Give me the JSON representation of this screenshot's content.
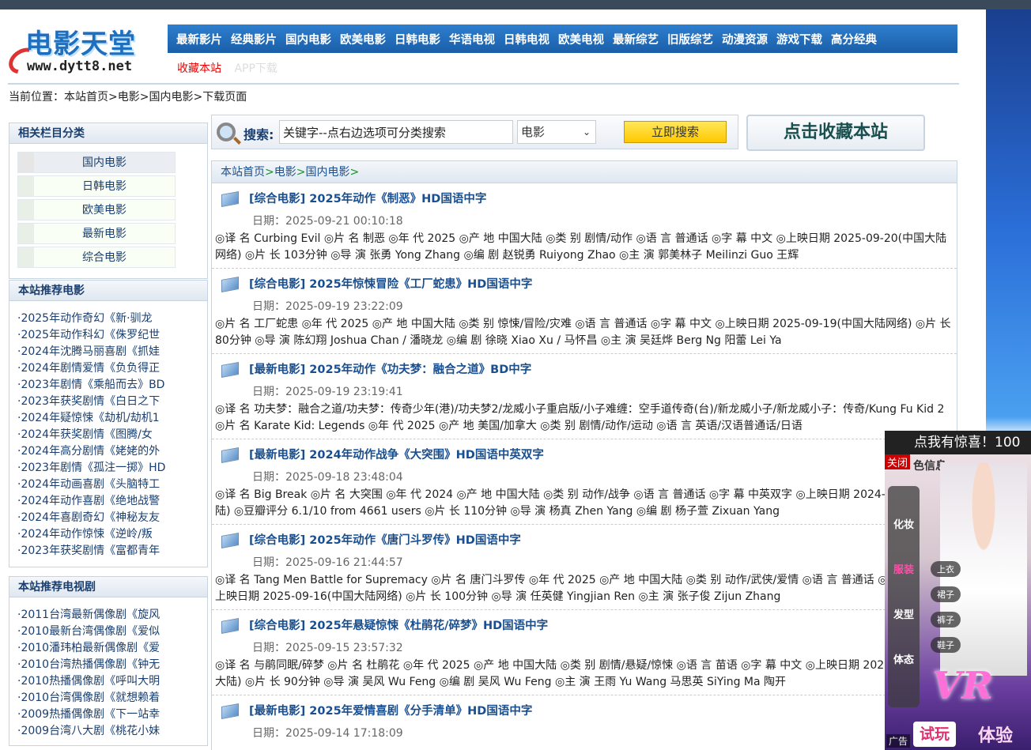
{
  "logo": {
    "brand": "电影天堂",
    "url": "www.dytt8.net"
  },
  "nav": [
    "最新影片",
    "经典影片",
    "国内电影",
    "欧美电影",
    "日韩电影",
    "华语电视",
    "日韩电视",
    "欧美电视",
    "最新综艺",
    "旧版综艺",
    "动漫资源",
    "游戏下载",
    "高分经典"
  ],
  "subnav": {
    "favorite": "收藏本站",
    "app": "APP下载"
  },
  "location": {
    "prefix": "当前位置：",
    "path": [
      "本站首页",
      "电影",
      "国内电影",
      "下载页面"
    ],
    "sep": ">"
  },
  "categories": {
    "title": "相关栏目分类",
    "items": [
      "国内电影",
      "日韩电影",
      "欧美电影",
      "最新电影",
      "综合电影"
    ]
  },
  "rec_movies": {
    "title": "本站推荐电影",
    "items": [
      "·2025年动作奇幻《新·驯龙",
      "·2025年动作科幻《侏罗纪世",
      "·2024年沈腾马丽喜剧《抓娃",
      "·2024年剧情爱情《负负得正",
      "·2023年剧情《乘船而去》BD",
      "·2023年获奖剧情《白日之下",
      "·2024年疑惊悚《劫机/劫机1",
      "·2024年获奖剧情《图腾/女",
      "·2024年高分剧情《姥姥的外",
      "·2023年剧情《孤注一掷》HD",
      "·2024年动画喜剧《头脑特工",
      "·2024年动作喜剧《绝地战警",
      "·2024年喜剧奇幻《神秘友友",
      "·2024年动作惊悚《逆岭/叛",
      "·2023年获奖剧情《富都青年"
    ]
  },
  "rec_tv": {
    "title": "本站推荐电视剧",
    "items": [
      "·2011台湾最新偶像剧《旋风",
      "·2010最新台湾偶像剧《爱似",
      "·2010潘玮柏最新偶像剧《爱",
      "·2010台湾热播偶像剧《钟无",
      "·2010热播偶像剧《呼叫大明",
      "·2010台湾偶像剧《就想赖着",
      "·2009热播偶像剧《下一站幸",
      "·2009台湾八大剧《桃花小妹"
    ]
  },
  "search": {
    "label": "搜索:",
    "value": "关键字--点右边选项可分类搜索",
    "type": "电影",
    "button": "立即搜索"
  },
  "fav_button": "点击收藏本站",
  "main_crumb": [
    "本站首页",
    "电影",
    "国内电影"
  ],
  "items": [
    {
      "title": "[综合电影] 2025年动作《制恶》HD国语中字",
      "date": "日期：2025-09-21 00:10:18",
      "desc": "◎译 名 Curbing Evil ◎片 名 制恶 ◎年 代 2025 ◎产 地 中国大陆 ◎类 别 剧情/动作 ◎语 言 普通话 ◎字 幕 中文 ◎上映日期 2025-09-20(中国大陆网络) ◎片 长 103分钟 ◎导 演 张勇 Yong Zhang ◎编 剧 赵锐勇 Ruiyong Zhao ◎主 演 郭美林子 Meilinzi Guo 王辉"
    },
    {
      "title": "[综合电影] 2025年惊悚冒险《工厂蛇患》HD国语中字",
      "date": "日期：2025-09-19 23:22:09",
      "desc": "◎片 名 工厂蛇患 ◎年 代 2025 ◎产 地 中国大陆 ◎类 别 惊悚/冒险/灾难 ◎语 言 普通话 ◎字 幕 中文 ◎上映日期 2025-09-19(中国大陆网络) ◎片 长 80分钟 ◎导 演 陈幻翔 Joshua Chan / 潘晓龙 ◎编 剧 徐晓 Xiao Xu / 马怀昌 ◎主 演 吴廷烨 Berg Ng 阳蕾 Lei Ya"
    },
    {
      "title": "[最新电影] 2025年动作《功夫梦：融合之道》BD中字",
      "date": "日期：2025-09-19 23:19:41",
      "desc": "◎译 名 功夫梦：融合之道/功夫梦：传奇少年(港)/功夫梦2/龙威小子重启版/小子难缠：空手道传奇(台)/新龙威小子/新龙威小子：传奇/Kung Fu Kid 2 ◎片 名 Karate Kid: Legends ◎年 代 2025 ◎产 地 美国/加拿大 ◎类 别 剧情/动作/运动 ◎语 言 英语/汉语普通话/日语"
    },
    {
      "title": "[最新电影] 2024年动作战争《大突围》HD国语中英双字",
      "date": "日期：2025-09-18 23:48:04",
      "desc": "◎译 名 Big Break ◎片 名 大突围 ◎年 代 2024 ◎产 地 中国大陆 ◎类 别 动作/战争 ◎语 言 普通话 ◎字 幕 中英双字 ◎上映日期 2024-11-29(中国大陆) ◎豆瓣评分 6.1/10 from 4661 users ◎片 长 110分钟 ◎导 演 杨真 Zhen Yang ◎编 剧 杨子萱 Zixuan Yang"
    },
    {
      "title": "[综合电影] 2025年动作《唐门斗罗传》HD国语中字",
      "date": "日期：2025-09-16 21:44:57",
      "desc": "◎译 名 Tang Men Battle for Supremacy ◎片 名 唐门斗罗传 ◎年 代 2025 ◎产 地 中国大陆 ◎类 别 动作/武侠/爱情 ◎语 言 普通话 ◎字 幕 中文 ◎上映日期 2025-09-16(中国大陆网络) ◎片 长 100分钟 ◎导 演 任英健 Yingjian Ren ◎主 演 张子俊 Zijun Zhang"
    },
    {
      "title": "[综合电影] 2025年悬疑惊悚《杜鹃花/碎梦》HD国语中字",
      "date": "日期：2025-09-15 23:57:32",
      "desc": "◎译 名 与鹃同眠/碎梦 ◎片 名 杜鹃花 ◎年 代 2025 ◎产 地 中国大陆 ◎类 别 剧情/悬疑/惊悚 ◎语 言 苗语 ◎字 幕 中文 ◎上映日期 2025-09-25(中国大陆) ◎片 长 90分钟 ◎导 演 吴风 Wu Feng ◎编 剧 吴风 Wu Feng ◎主 演 王雨 Yu Wang 马思英 SiYing Ma 陶开"
    },
    {
      "title": "[最新电影] 2025年爱情喜剧《分手清单》HD国语中字",
      "date": "日期：2025-09-14 17:18:09",
      "desc": ""
    }
  ],
  "ad": {
    "headline": "点我有惊喜！100",
    "close": "关闭",
    "color_info": "色信息",
    "menu": [
      "化妆",
      "服装",
      "发型",
      "体态"
    ],
    "chips": [
      "上衣",
      "裙子",
      "裤子",
      "鞋子"
    ],
    "brand": "VR",
    "try": "试玩",
    "experience": "体验",
    "tag": "广告"
  }
}
